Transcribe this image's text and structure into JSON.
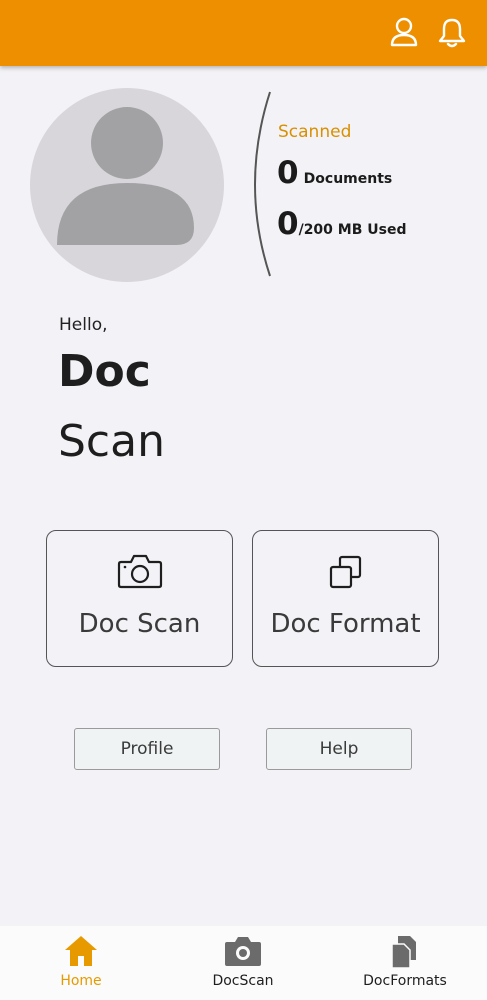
{
  "header": {
    "background": "#ee8f00",
    "icons": [
      "user-icon",
      "bell-icon"
    ]
  },
  "stats": {
    "scanned_label": "Scanned",
    "documents_count": "0",
    "documents_label": "Documents",
    "storage_used": "0",
    "storage_label": "/200 MB Used"
  },
  "greeting": {
    "hello": "Hello,",
    "name_line1": "Doc",
    "name_line2": "Scan"
  },
  "cards": [
    {
      "label": "Doc Scan",
      "icon": "camera-icon"
    },
    {
      "label": "Doc Format",
      "icon": "copy-icon"
    }
  ],
  "buttons": {
    "profile": "Profile",
    "help": "Help"
  },
  "bottom_nav": {
    "items": [
      {
        "label": "Home",
        "icon": "home-icon",
        "active": true
      },
      {
        "label": "DocScan",
        "icon": "camera-icon",
        "active": false
      },
      {
        "label": "DocFormats",
        "icon": "documents-icon",
        "active": false
      }
    ],
    "active_color": "#e69a00"
  }
}
